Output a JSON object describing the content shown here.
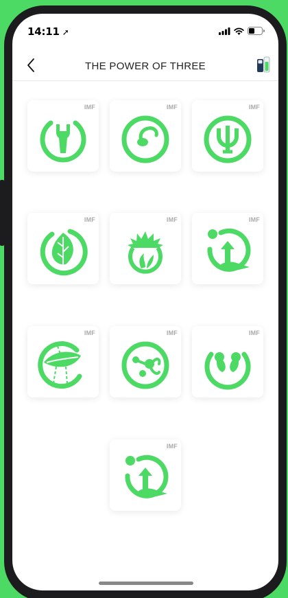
{
  "status_bar": {
    "time": "14:11",
    "location_glyph": "➚"
  },
  "header": {
    "title": "THE POWER OF THREE",
    "back_icon": "chevron-left-icon",
    "right_icon": "battery-tube-icon"
  },
  "accent_color": "#4cd964",
  "apps": [
    {
      "badge": "IMF",
      "icon": "wrench-circle-icon"
    },
    {
      "badge": "IMF",
      "icon": "sperm-circle-icon"
    },
    {
      "badge": "IMF",
      "icon": "psi-circle-icon"
    },
    {
      "badge": "IMF",
      "icon": "leaf-circle-icon"
    },
    {
      "badge": "IMF",
      "icon": "sprout-sun-icon"
    },
    {
      "badge": "IMF",
      "icon": "growth-arrow-icon"
    },
    {
      "badge": "IMF",
      "icon": "leaf-rain-icon"
    },
    {
      "badge": "IMF",
      "icon": "cells-circle-icon"
    },
    {
      "badge": "IMF",
      "icon": "two-drops-icon"
    },
    {
      "badge": "IMF",
      "icon": "growth-arrow-icon"
    }
  ]
}
